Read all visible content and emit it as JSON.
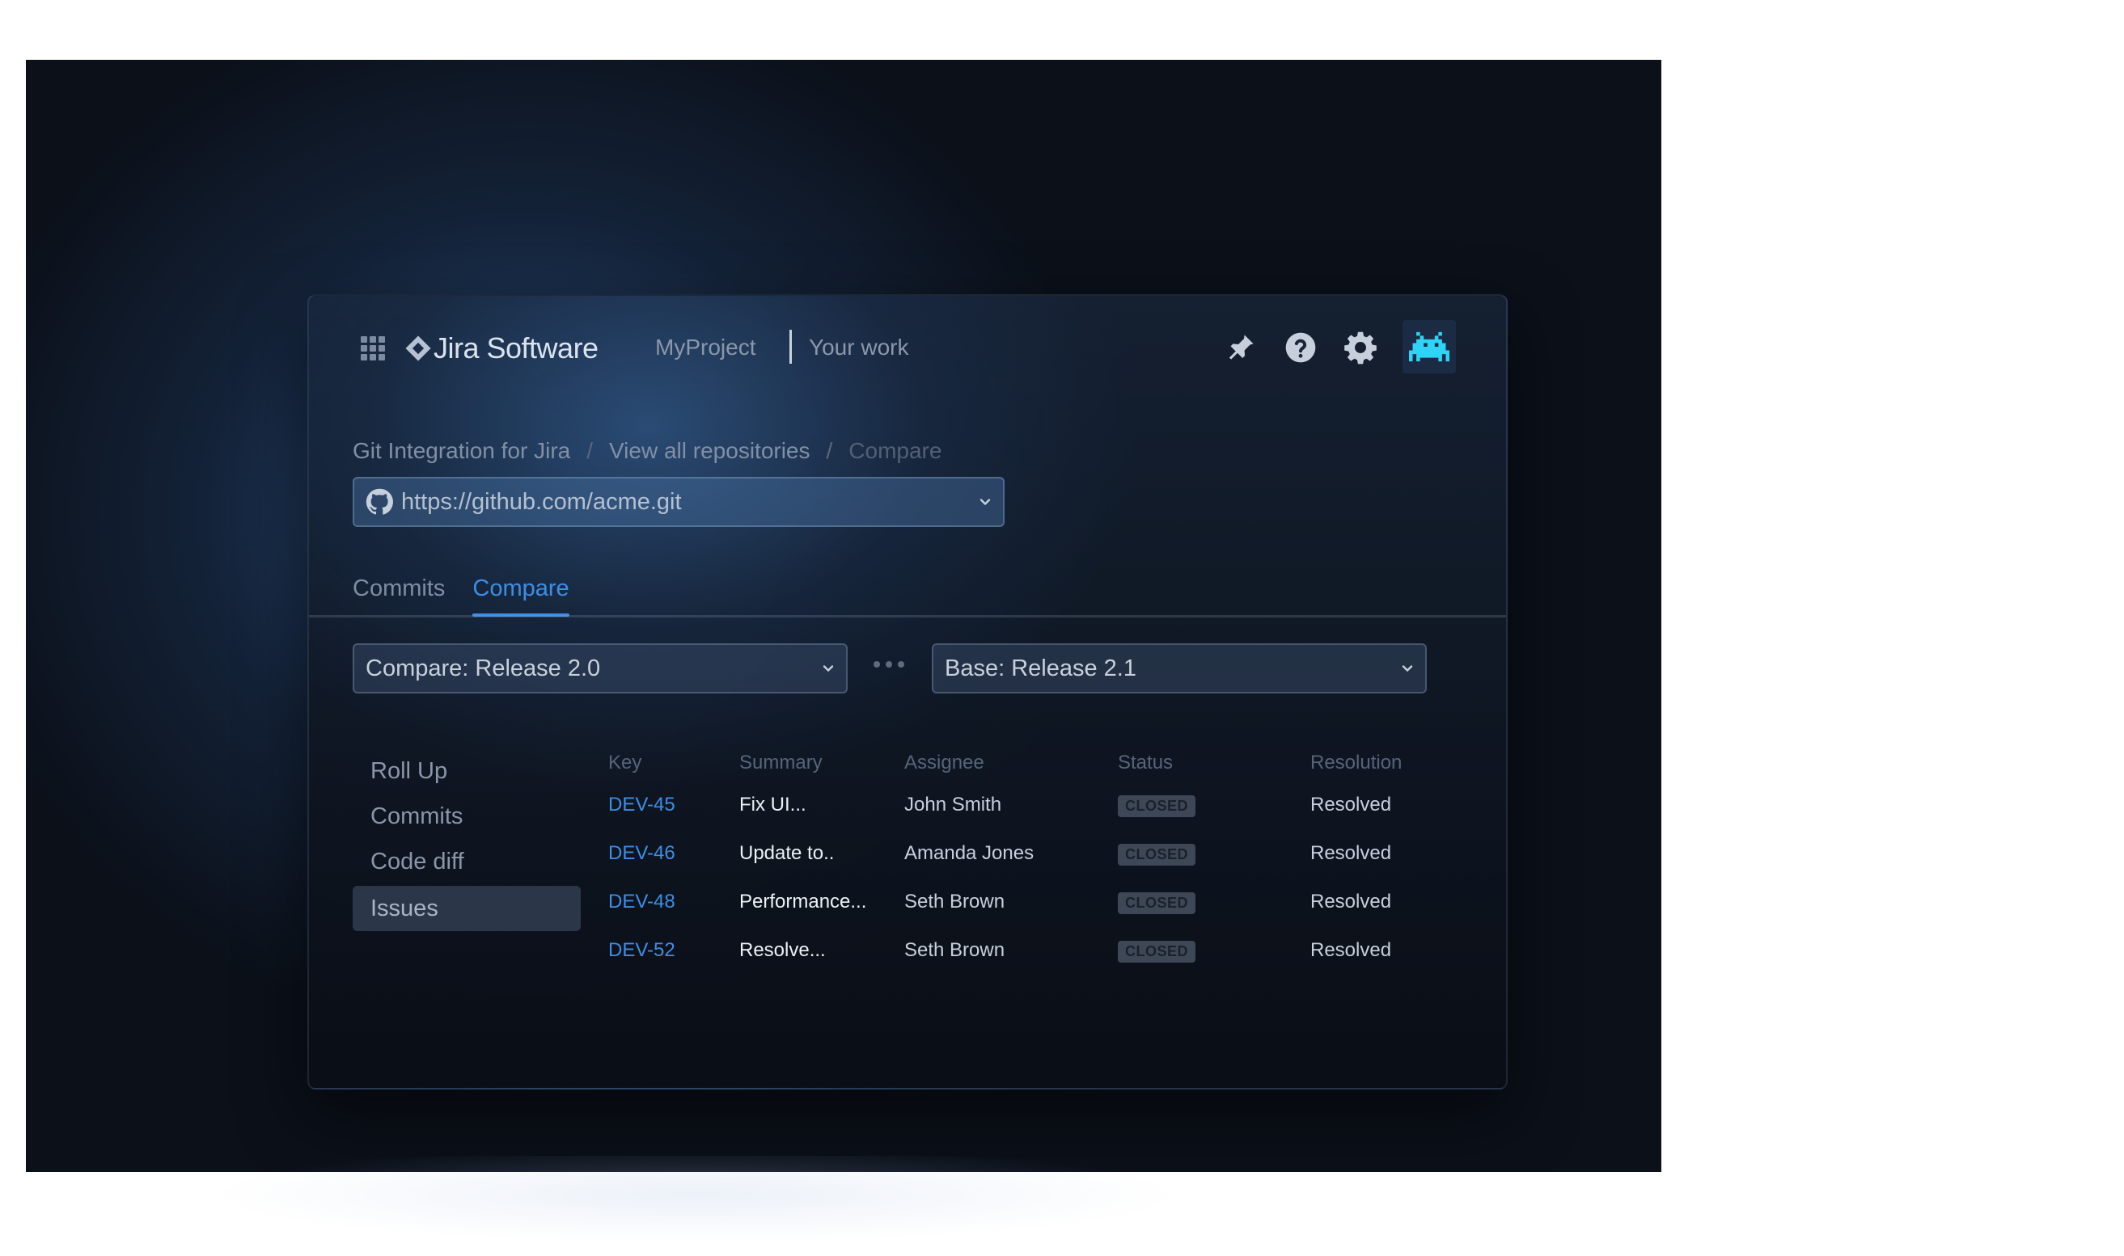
{
  "nav": {
    "product_name": "Jira Software",
    "links": [
      "MyProject",
      "Your work"
    ],
    "icons": [
      "apps-grid-icon",
      "jira-logo-icon",
      "notification-icon",
      "help-icon",
      "settings-icon",
      "avatar"
    ]
  },
  "breadcrumb": {
    "items": [
      "Git Integration for Jira",
      "View all repositories",
      "Compare"
    ],
    "separator": "/"
  },
  "repo": {
    "url": "https://github.com/acme.git"
  },
  "tabs": [
    {
      "label": "Commits",
      "active": false
    },
    {
      "label": "Compare",
      "active": true
    }
  ],
  "compare": {
    "compare_label": "Compare: Release 2.0",
    "base_label": "Base: Release 2.1"
  },
  "sidebar": {
    "items": [
      {
        "label": "Roll Up",
        "active": false
      },
      {
        "label": "Commits",
        "active": false
      },
      {
        "label": "Code diff",
        "active": false
      },
      {
        "label": "Issues",
        "active": true
      }
    ]
  },
  "table": {
    "headers": [
      "Key",
      "Summary",
      "Assignee",
      "Status",
      "Resolution"
    ],
    "rows": [
      {
        "key": "DEV-45",
        "summary": "Fix UI...",
        "assignee": "John Smith",
        "status": "CLOSED",
        "resolution": "Resolved"
      },
      {
        "key": "DEV-46",
        "summary": "Update to..",
        "assignee": "Amanda Jones",
        "status": "CLOSED",
        "resolution": "Resolved"
      },
      {
        "key": "DEV-48",
        "summary": "Performance...",
        "assignee": "Seth Brown",
        "status": "CLOSED",
        "resolution": "Resolved"
      },
      {
        "key": "DEV-52",
        "summary": "Resolve...",
        "assignee": "Seth Brown",
        "status": "CLOSED",
        "resolution": "Resolved"
      }
    ]
  },
  "colors": {
    "accent": "#3d8ee6",
    "background": "#0b1019",
    "badge": "#3d4756",
    "avatar_icon": "#2fd3f5"
  }
}
